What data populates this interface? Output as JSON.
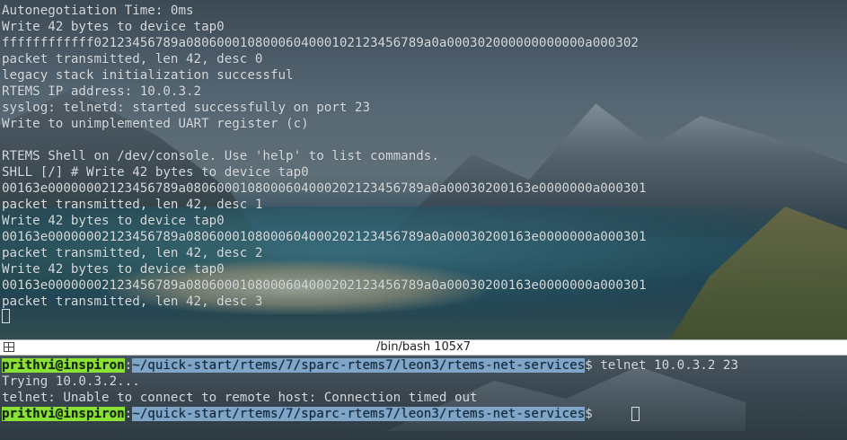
{
  "top_terminal": {
    "lines": [
      "Autonegotiation Time: 0ms",
      "Write 42 bytes to device tap0",
      "ffffffffffff02123456789a080600010800060400010212345678 9a0a000302000000000000a000302",
      "packet transmitted, len 42, desc 0",
      "legacy stack initialization successful",
      "RTEMS IP address: 10.0.3.2",
      "syslog: telnetd: started successfully on port 23",
      "Write to unimplemented UART register (c)",
      "",
      "RTEMS Shell on /dev/console. Use 'help' to list commands.",
      "SHLL [/] # Write 42 bytes to device tap0",
      "00163e0000000212345678 9a0806000108000604000202123456789a0a00030200163e0000000a000301",
      "packet transmitted, len 42, desc 1",
      "Write 42 bytes to device tap0",
      "00163e0000000212345678 9a0806000108000604000202123456789a0a00030200163e0000000a000301",
      "packet transmitted, len 42, desc 2",
      "Write 42 bytes to device tap0",
      "00163e0000000212345678 9a0806000108000604000202123456789a0a00030200163e0000000a000301",
      "packet transmitted, len 42, desc 3"
    ]
  },
  "title_bar": {
    "title": "/bin/bash 105x7",
    "split_icon": "split-pane-icon"
  },
  "bottom_terminal": {
    "prompt_user": "prithvi@inspiron",
    "prompt_path": "~/quick-start/rtems/7/sparc-rtems7/leon3/rtems-net-services",
    "command1": "$ telnet 10.0.3.2 23",
    "output1": "Trying 10.0.3.2...",
    "output2": "telnet: Unable to connect to remote host: Connection timed out",
    "prompt_suffix": "$ "
  }
}
